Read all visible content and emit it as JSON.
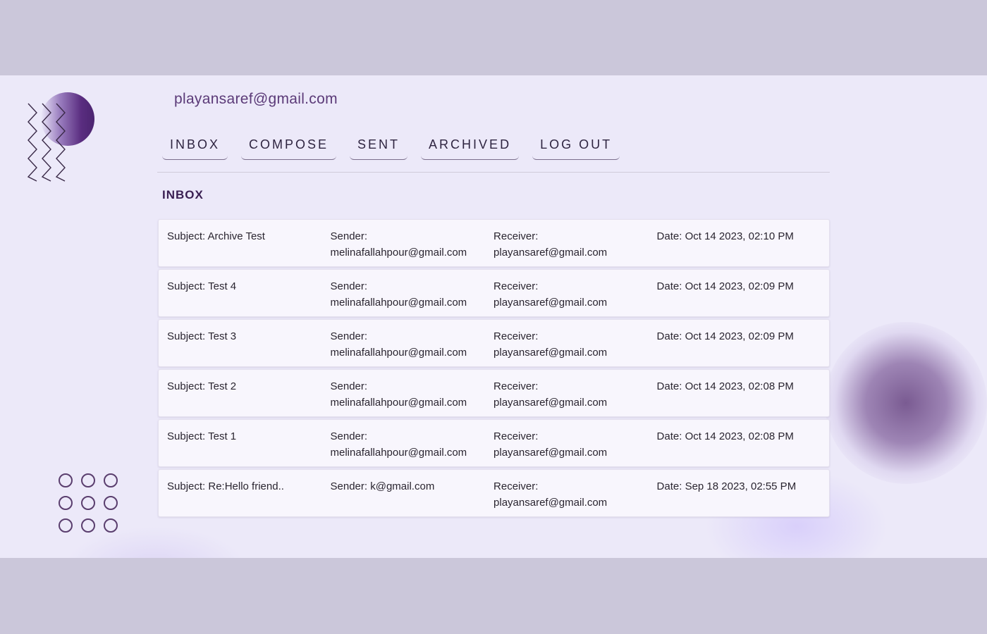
{
  "account": {
    "email": "playansaref@gmail.com"
  },
  "nav": {
    "items": [
      {
        "label": "INBOX"
      },
      {
        "label": "COMPOSE"
      },
      {
        "label": "SENT"
      },
      {
        "label": "ARCHIVED"
      },
      {
        "label": "LOG OUT"
      }
    ]
  },
  "section": {
    "title": "INBOX"
  },
  "emails": [
    {
      "subject": "Subject: Archive Test",
      "sender_label": "Sender:",
      "sender": "melinafallahpour@gmail.com",
      "receiver_label": "Receiver:",
      "receiver": "playansaref@gmail.com",
      "date": "Date: Oct 14 2023, 02:10 PM"
    },
    {
      "subject": "Subject: Test 4",
      "sender_label": "Sender:",
      "sender": "melinafallahpour@gmail.com",
      "receiver_label": "Receiver:",
      "receiver": "playansaref@gmail.com",
      "date": "Date: Oct 14 2023, 02:09 PM"
    },
    {
      "subject": "Subject: Test 3",
      "sender_label": "Sender:",
      "sender": "melinafallahpour@gmail.com",
      "receiver_label": "Receiver:",
      "receiver": "playansaref@gmail.com",
      "date": "Date: Oct 14 2023, 02:09 PM"
    },
    {
      "subject": "Subject: Test 2",
      "sender_label": "Sender:",
      "sender": "melinafallahpour@gmail.com",
      "receiver_label": "Receiver:",
      "receiver": "playansaref@gmail.com",
      "date": "Date: Oct 14 2023, 02:08 PM"
    },
    {
      "subject": "Subject: Test 1",
      "sender_label": "Sender:",
      "sender": "melinafallahpour@gmail.com",
      "receiver_label": "Receiver:",
      "receiver": "playansaref@gmail.com",
      "date": "Date: Oct 14 2023, 02:08 PM"
    },
    {
      "subject": "Subject: Re:Hello friend..",
      "sender_label": "Sender:",
      "sender": "k@gmail.com",
      "receiver_label": "Receiver:",
      "receiver": "playansaref@gmail.com",
      "date": "Date: Sep 18 2023, 02:55 PM",
      "sender_inline": true
    }
  ],
  "colors": {
    "page_background": "#cbc7da",
    "app_background": "#ece9f9",
    "accent": "#5b3a78",
    "row_background": "#f8f6fd"
  }
}
